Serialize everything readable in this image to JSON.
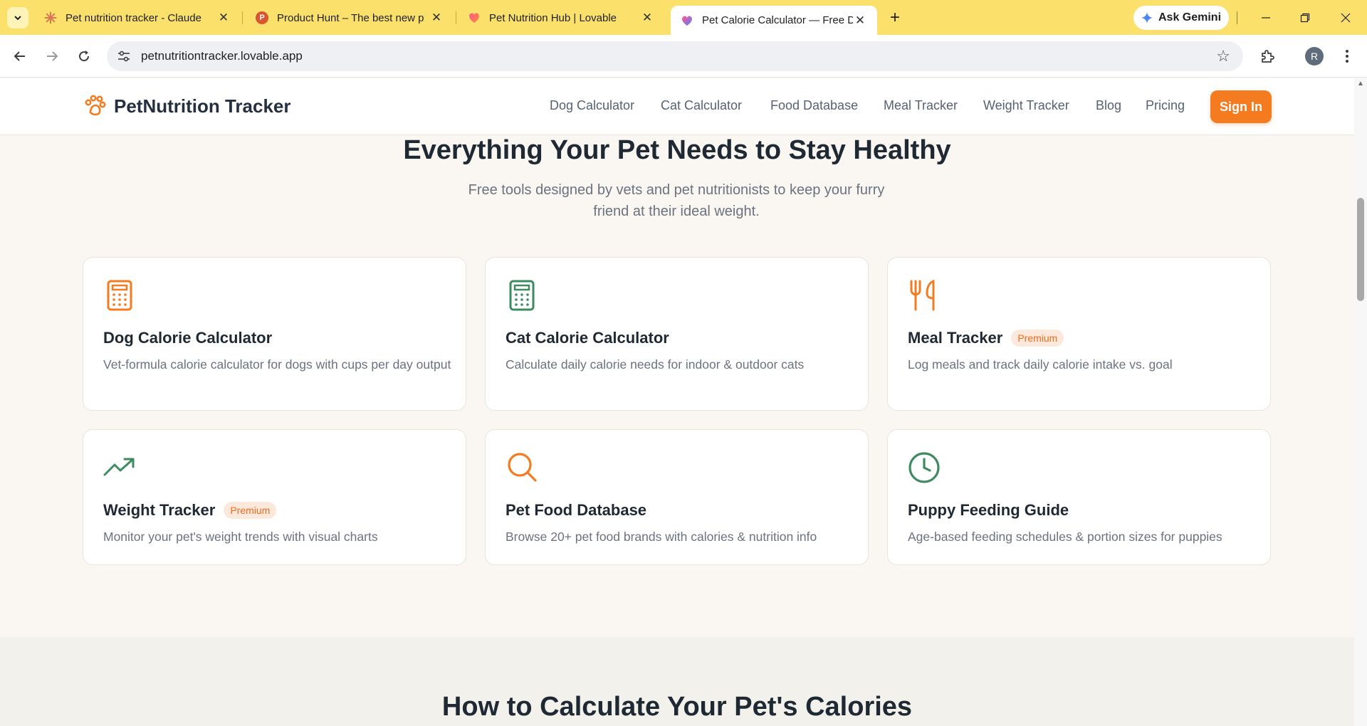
{
  "browser": {
    "tabs": [
      {
        "title": "Pet nutrition tracker - Claude",
        "active": false
      },
      {
        "title": "Product Hunt – The best new p",
        "active": false
      },
      {
        "title": "Pet Nutrition Hub | Lovable",
        "active": false
      },
      {
        "title": "Pet Calorie Calculator — Free D",
        "active": true
      }
    ],
    "gemini_label": "Ask Gemini",
    "url": "petnutritiontracker.lovable.app",
    "profile_initial": "R",
    "tab_colors": {
      "bar": "#fbe16c",
      "active": "#ffffff"
    }
  },
  "site": {
    "logo_text": "PetNutrition Tracker",
    "nav": [
      "Dog Calculator",
      "Cat Calculator",
      "Food Database",
      "Meal Tracker",
      "Weight Tracker",
      "Blog",
      "Pricing"
    ],
    "signin_label": "Sign In",
    "accent_color": "#f47b20",
    "green_color": "#3e8b62"
  },
  "hero": {
    "title": "Everything Your Pet Needs to Stay Healthy",
    "subtitle": "Free tools designed by vets and pet nutritionists to keep your furry friend at their ideal weight."
  },
  "cards": [
    {
      "icon": "calculator-icon",
      "title": "Dog Calorie Calculator",
      "badge": "",
      "desc": "Vet-formula calorie calculator for dogs with cups per day output"
    },
    {
      "icon": "calculator-icon",
      "title": "Cat Calorie Calculator",
      "badge": "",
      "desc": "Calculate daily calorie needs for indoor & outdoor cats"
    },
    {
      "icon": "utensils-icon",
      "title": "Meal Tracker",
      "badge": "Premium",
      "desc": "Log meals and track daily calorie intake vs. goal"
    },
    {
      "icon": "trending-up-icon",
      "title": "Weight Tracker",
      "badge": "Premium",
      "desc": "Monitor your pet's weight trends with visual charts"
    },
    {
      "icon": "search-icon",
      "title": "Pet Food Database",
      "badge": "",
      "desc": "Browse 20+ pet food brands with calories & nutrition info"
    },
    {
      "icon": "clock-icon",
      "title": "Puppy Feeding Guide",
      "badge": "",
      "desc": "Age-based feeding schedules & portion sizes for puppies"
    }
  ],
  "section2": {
    "title": "How to Calculate Your Pet's Calories"
  }
}
